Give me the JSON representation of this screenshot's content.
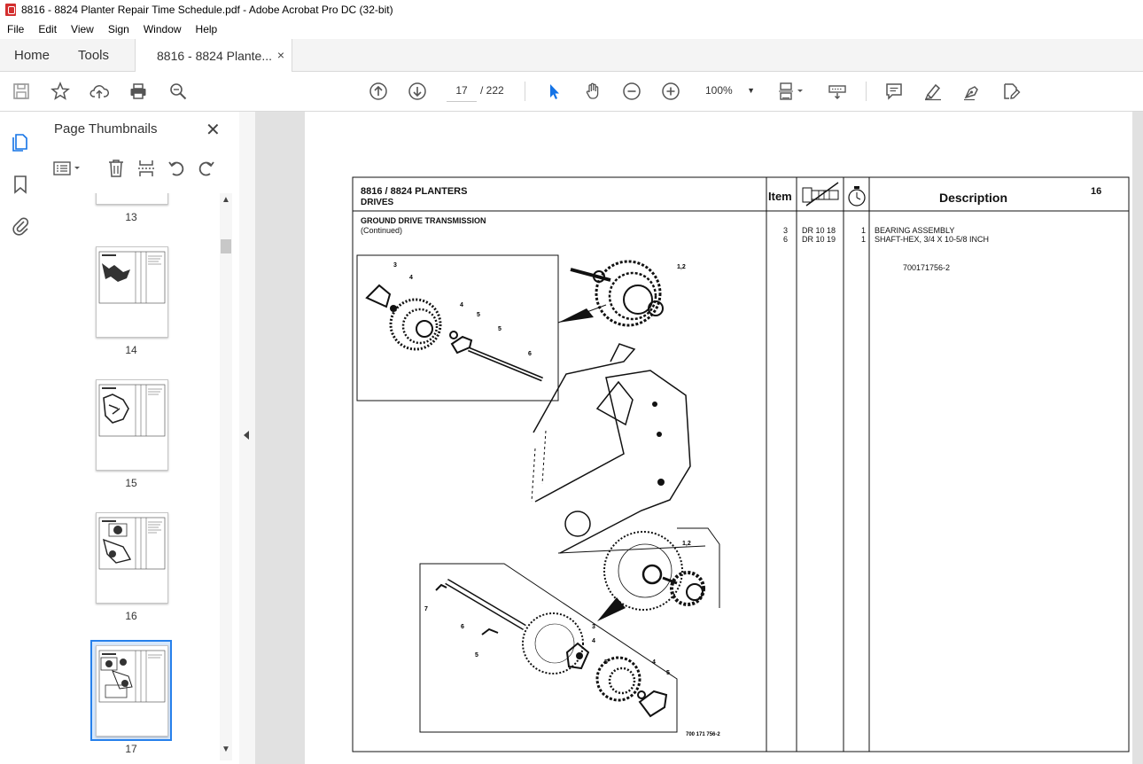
{
  "window": {
    "title": "8816 - 8824 Planter Repair Time Schedule.pdf - Adobe Acrobat Pro DC (32-bit)"
  },
  "menu": [
    "File",
    "Edit",
    "View",
    "Sign",
    "Window",
    "Help"
  ],
  "tabs": {
    "home": "Home",
    "tools": "Tools",
    "document": "8816 - 8824 Plante...",
    "close": "×"
  },
  "toolbar": {
    "page_current": "17",
    "page_total": "/  222",
    "zoom": "100%"
  },
  "sidebar": {
    "title": "Page Thumbnails",
    "close": "✕",
    "thumbnails": [
      {
        "label": "13"
      },
      {
        "label": "14"
      },
      {
        "label": "15"
      },
      {
        "label": "16"
      },
      {
        "label": "17",
        "selected": true
      }
    ]
  },
  "document": {
    "header_title": "8816 / 8824 PLANTERS",
    "header_subtitle": "DRIVES",
    "col_item": "Item",
    "col_description": "Description",
    "page_number": "16",
    "section_title": "GROUND DRIVE TRANSMISSION",
    "section_note": "(Continued)",
    "parts": [
      {
        "item": "3",
        "part": "DR 10 18",
        "qty": "1",
        "description": "BEARING ASSEMBLY"
      },
      {
        "item": "6",
        "part": "DR 10 19",
        "qty": "1",
        "description": "SHAFT-HEX, 3/4 X 10-5/8 INCH"
      }
    ],
    "reference": "700171756-2",
    "figure_code": "700 171 756-2",
    "callouts": [
      "3",
      "4",
      "4",
      "5",
      "5",
      "6",
      "1,2",
      "1,2",
      "7",
      "6",
      "5",
      "3",
      "4",
      "5",
      "4",
      "5"
    ]
  },
  "colors": {
    "accent": "#d32f2f",
    "canvas": "#e1e1e1",
    "selected_thumb": "#2680eb"
  }
}
